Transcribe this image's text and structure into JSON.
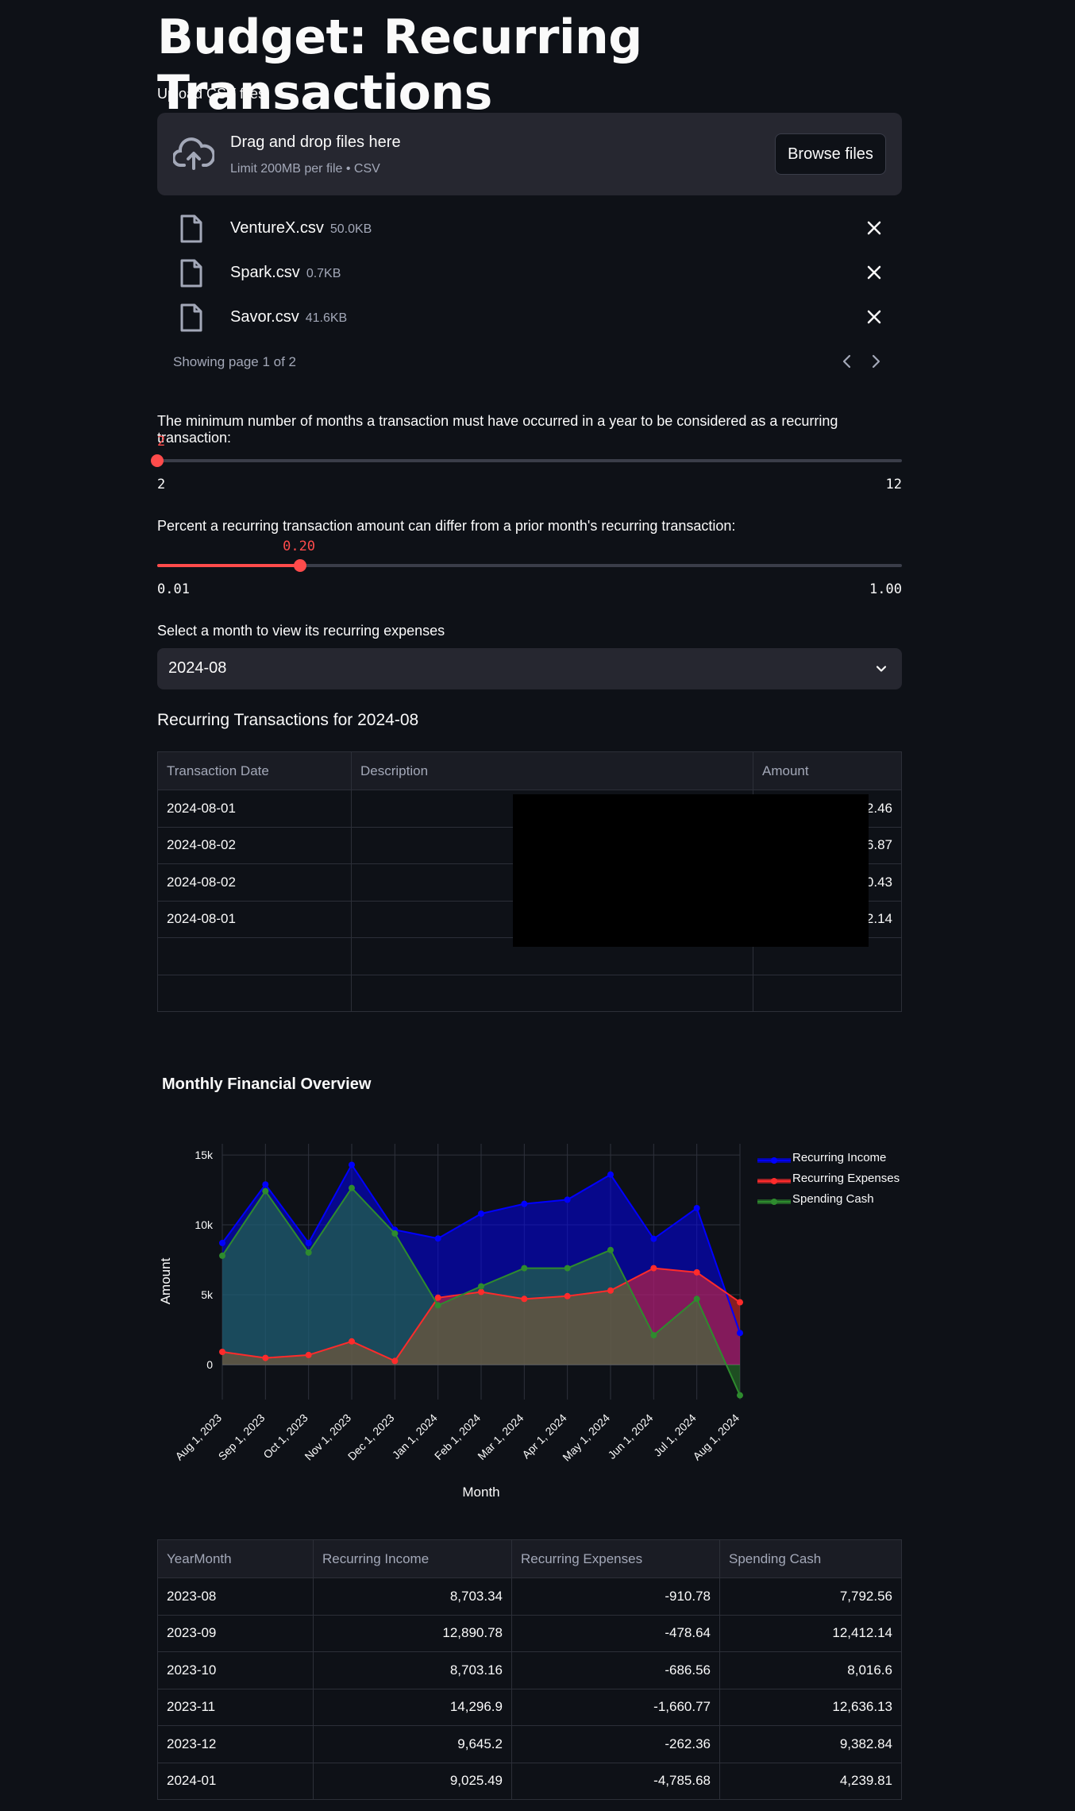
{
  "page": {
    "title": "Budget: Recurring Transactions"
  },
  "uploader": {
    "label": "Upload CSV files",
    "drop_title": "Drag and drop files here",
    "drop_sub": "Limit 200MB per file • CSV",
    "browse_label": "Browse files",
    "files": [
      {
        "name": "VentureX.csv",
        "size": "50.0KB"
      },
      {
        "name": "Spark.csv",
        "size": "0.7KB"
      },
      {
        "name": "Savor.csv",
        "size": "41.6KB"
      }
    ],
    "pager": "Showing page 1 of 2",
    "icons": [
      "upload-cloud-icon",
      "file-icon",
      "close-icon",
      "chevron-left-icon",
      "chevron-right-icon"
    ]
  },
  "slider_months": {
    "label": "The minimum number of months a transaction must have occurred in a year to be considered as a recurring transaction:",
    "value": "2",
    "min": "2",
    "max": "12",
    "fraction": 0
  },
  "slider_percent": {
    "label": "Percent a recurring transaction amount can differ from a prior month's recurring transaction:",
    "value": "0.20",
    "min": "0.01",
    "max": "1.00",
    "fraction": 0.192
  },
  "month_select": {
    "label": "Select a month to view its recurring expenses",
    "value": "2024-08"
  },
  "transactions": {
    "title": "Recurring Transactions for 2024-08",
    "columns": [
      "Transaction Date",
      "Description",
      "Amount"
    ],
    "rows": [
      {
        "date": "2024-08-01",
        "desc": "",
        "amount": "2,262.46"
      },
      {
        "date": "2024-08-02",
        "desc": "",
        "amount": "-4,226.87"
      },
      {
        "date": "2024-08-02",
        "desc": "",
        "amount": "-0.43"
      },
      {
        "date": "2024-08-01",
        "desc": "",
        "amount": "-232.14"
      },
      {
        "date": "",
        "desc": "",
        "amount": ""
      },
      {
        "date": "",
        "desc": "",
        "amount": ""
      }
    ]
  },
  "colors": {
    "accent": "#ff4b4b",
    "income": "#0000ff",
    "expenses": "#ff2b2b",
    "spending": "#2e8b2e",
    "bg": "#0e1117"
  },
  "chart_data": {
    "type": "area",
    "title": "Monthly Financial Overview",
    "xlabel": "Month",
    "ylabel": "Amount",
    "x": [
      "Aug 1, 2023",
      "Sep 1, 2023",
      "Oct 1, 2023",
      "Nov 1, 2023",
      "Dec 1, 2023",
      "Jan 1, 2024",
      "Feb 1, 2024",
      "Mar 1, 2024",
      "Apr 1, 2024",
      "May 1, 2024",
      "Jun 1, 2024",
      "Jul 1, 2024",
      "Aug 1, 2024"
    ],
    "yticks": [
      0,
      5000,
      10000,
      15000
    ],
    "ytick_labels": [
      "0",
      "5k",
      "10k",
      "15k"
    ],
    "ylim": [
      -2500,
      15800
    ],
    "legend_placement": "top-right",
    "series": [
      {
        "name": "Recurring Income",
        "color": "#0000ff",
        "values": [
          8703.34,
          12890.78,
          8703.16,
          14296.9,
          9645.2,
          9025.49,
          10800,
          11500,
          11800,
          13600,
          9000,
          11200,
          2262.46
        ]
      },
      {
        "name": "Recurring Expenses",
        "color": "#ff2b2b",
        "values": [
          910.78,
          478.64,
          686.56,
          1660.77,
          262.36,
          4785.68,
          5200,
          4700,
          4900,
          5300,
          6900,
          6600,
          4459.44
        ]
      },
      {
        "name": "Spending Cash",
        "color": "#2e8b2e",
        "values": [
          7792.56,
          12412.14,
          8016.6,
          12636.13,
          9382.84,
          4239.81,
          5600,
          6900,
          6900,
          8200,
          2100,
          4700,
          -2196.98
        ]
      }
    ]
  },
  "summary_table": {
    "columns": [
      "YearMonth",
      "Recurring Income",
      "Recurring Expenses",
      "Spending Cash"
    ],
    "rows": [
      [
        "2023-08",
        "8,703.34",
        "-910.78",
        "7,792.56"
      ],
      [
        "2023-09",
        "12,890.78",
        "-478.64",
        "12,412.14"
      ],
      [
        "2023-10",
        "8,703.16",
        "-686.56",
        "8,016.6"
      ],
      [
        "2023-11",
        "14,296.9",
        "-1,660.77",
        "12,636.13"
      ],
      [
        "2023-12",
        "9,645.2",
        "-262.36",
        "9,382.84"
      ],
      [
        "2024-01",
        "9,025.49",
        "-4,785.68",
        "4,239.81"
      ]
    ]
  }
}
